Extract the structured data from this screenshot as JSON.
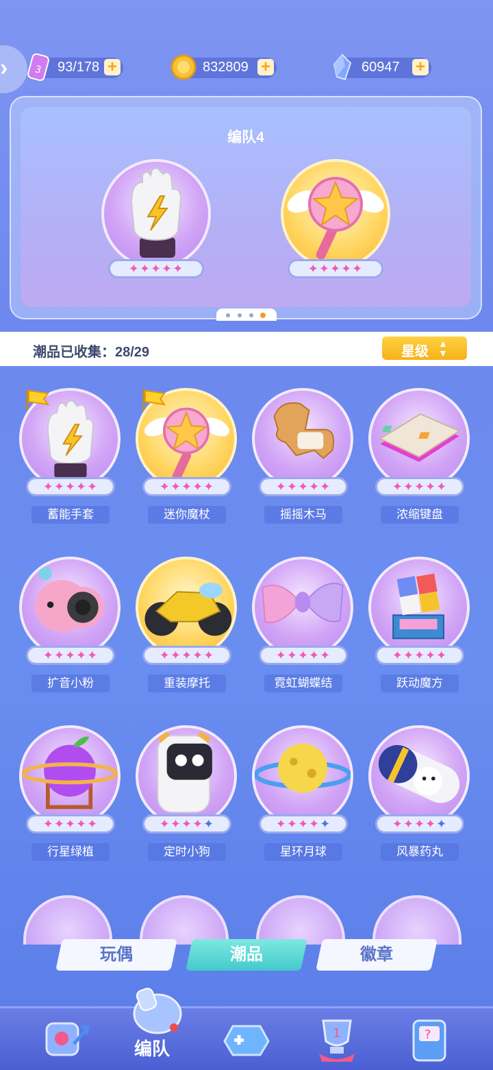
{
  "resources": {
    "energy": {
      "value": "93/178",
      "icon": "energy-can-icon"
    },
    "coins": {
      "value": "832809",
      "icon": "gold-coin-icon"
    },
    "gems": {
      "value": "60947",
      "icon": "crystal-icon"
    },
    "plus_label": "+"
  },
  "team": {
    "title": "编队4",
    "items": [
      {
        "icon": "energy-glove-icon",
        "stars_filled": 5,
        "stars_total": 5
      },
      {
        "icon": "mini-wand-icon",
        "stars_filled": 5,
        "stars_total": 5
      }
    ],
    "pages": 4,
    "current_page": 4
  },
  "collection": {
    "label": "潮品已收集：28/29",
    "sort_label": "星级"
  },
  "items": [
    {
      "name": "蓄能手套",
      "stars": 5,
      "color": "purple",
      "flag": true
    },
    {
      "name": "迷你魔杖",
      "stars": 5,
      "color": "gold",
      "flag": true
    },
    {
      "name": "摇摇木马",
      "stars": 5,
      "color": "purple",
      "flag": false
    },
    {
      "name": "浓缩键盘",
      "stars": 5,
      "color": "purple",
      "flag": false
    },
    {
      "name": "扩音小粉",
      "stars": 5,
      "color": "purple",
      "flag": false
    },
    {
      "name": "重装摩托",
      "stars": 5,
      "color": "gold",
      "flag": false
    },
    {
      "name": "霓虹蝴蝶结",
      "stars": 5,
      "color": "purple",
      "flag": false
    },
    {
      "name": "跃动魔方",
      "stars": 5,
      "color": "purple",
      "flag": false
    },
    {
      "name": "行星绿植",
      "stars": 5,
      "color": "purple",
      "flag": false
    },
    {
      "name": "定时小狗",
      "stars": 4,
      "color": "purple",
      "flag": false
    },
    {
      "name": "星环月球",
      "stars": 4,
      "color": "purple",
      "flag": false
    },
    {
      "name": "风暴药丸",
      "stars": 4,
      "color": "purple",
      "flag": false
    }
  ],
  "tabs": [
    {
      "label": "玩偶",
      "active": false
    },
    {
      "label": "潮品",
      "active": true
    },
    {
      "label": "徽章",
      "active": false
    }
  ],
  "nav": {
    "active_label": "编队",
    "icons": [
      "capsule-arrow-icon",
      "whistle-icon",
      "gamepad-icon",
      "trophy-icon",
      "mystery-box-icon"
    ]
  },
  "colors": {
    "accent": "#f6b21a",
    "star": "#f15ab5",
    "active_tab": "#44c9cc"
  }
}
